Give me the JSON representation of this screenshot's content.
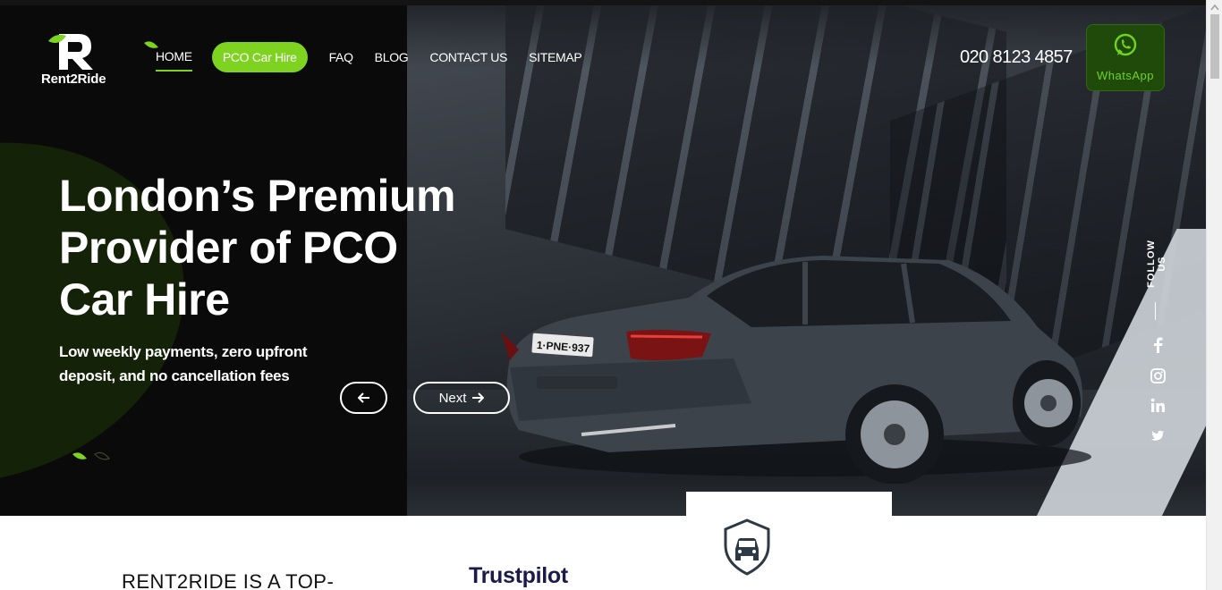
{
  "brand": {
    "name": "Rent2Ride"
  },
  "nav": {
    "items": [
      {
        "label": "HOME"
      },
      {
        "label": "PCO Car Hire"
      },
      {
        "label": "FAQ"
      },
      {
        "label": "BLOG"
      },
      {
        "label": "CONTACT US"
      },
      {
        "label": "SITEMAP"
      }
    ]
  },
  "contact": {
    "phone": "020 8123 4857",
    "whatsapp_label": "WhatsApp"
  },
  "hero": {
    "headline": "London’s Premium Provider of PCO Car Hire",
    "subheadline": "Low weekly payments, zero upfront deposit, and no cancellation fees",
    "next_label": "Next",
    "plate": "1·PNE·937"
  },
  "social": {
    "follow_label": "FOLLOW US",
    "icons": [
      "facebook-icon",
      "instagram-icon",
      "linkedin-icon",
      "twitter-icon"
    ]
  },
  "below": {
    "title": "RENT2RIDE IS A TOP-",
    "trustpilot": "Trustpilot"
  },
  "colors": {
    "accent": "#7ed321",
    "dark": "#0a0a0a",
    "whatsapp_bg": "#1f4a0a"
  }
}
